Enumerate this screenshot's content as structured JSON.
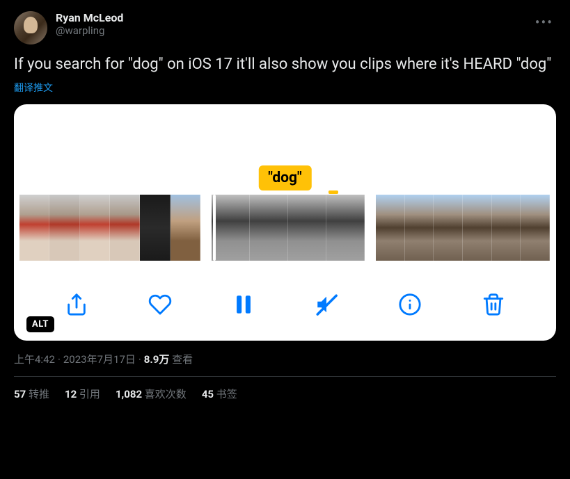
{
  "user": {
    "display_name": "Ryan McLeod",
    "handle": "@warpling"
  },
  "tweet_text": "If you search for \"dog\" on iOS 17 it'll also show you clips where it's HEARD \"dog\"",
  "translate_label": "翻译推文",
  "media": {
    "search_chip": "\"dog\"",
    "alt_badge": "ALT"
  },
  "meta": {
    "time": "上午4:42",
    "date": "2023年7月17日",
    "views_count": "8.9万",
    "views_label": "查看"
  },
  "stats": {
    "retweets_count": "57",
    "retweets_label": "转推",
    "quotes_count": "12",
    "quotes_label": "引用",
    "likes_count": "1,082",
    "likes_label": "喜欢次数",
    "bookmarks_count": "45",
    "bookmarks_label": "书签"
  }
}
